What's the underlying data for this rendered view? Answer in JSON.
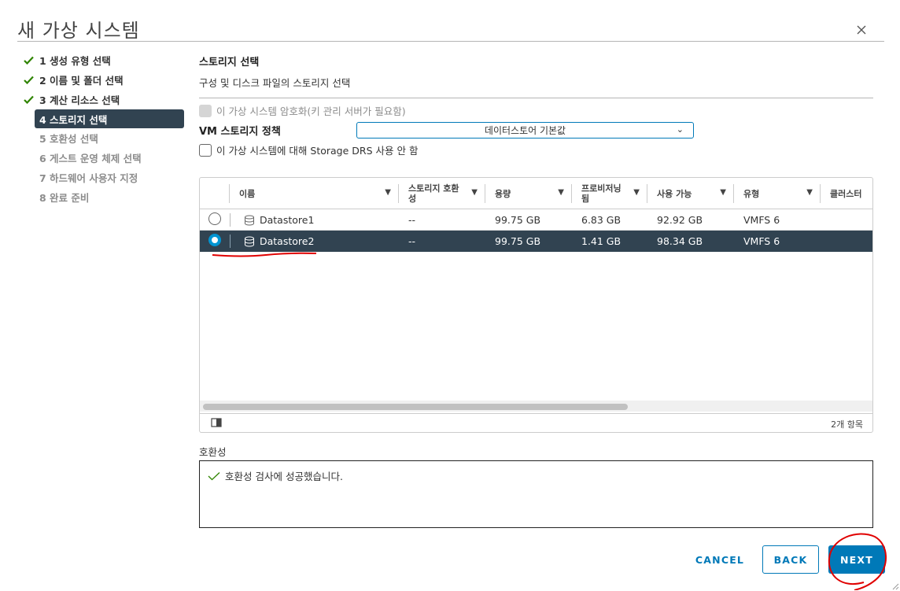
{
  "dialog": {
    "title": "새 가상 시스템"
  },
  "steps": [
    {
      "label": "1 생성 유형 선택",
      "state": "done"
    },
    {
      "label": "2 이름 및 폴더 선택",
      "state": "done"
    },
    {
      "label": "3 계산 리소스 선택",
      "state": "done"
    },
    {
      "label": "4 스토리지 선택",
      "state": "active"
    },
    {
      "label": "5 호환성 선택",
      "state": "future"
    },
    {
      "label": "6 게스트 운영 체제 선택",
      "state": "future"
    },
    {
      "label": "7 하드웨어 사용자 지정",
      "state": "future"
    },
    {
      "label": "8 완료 준비",
      "state": "future"
    }
  ],
  "section": {
    "title": "스토리지 선택",
    "subtitle": "구성 및 디스크 파일의 스토리지 선택"
  },
  "options": {
    "encrypt_label": "이 가상 시스템 암호화(키 관리 서버가 필요함)",
    "policy_label": "VM 스토리지 정책",
    "policy_value": "데이터스토어 기본값",
    "drs_label": "이 가상 시스템에 대해 Storage DRS 사용 안 함"
  },
  "grid": {
    "columns": [
      "이름",
      "스토리지 호환성",
      "용량",
      "프로비저닝됨",
      "사용 가능",
      "유형",
      "클러스터"
    ],
    "rows": [
      {
        "name": "Datastore1",
        "compat": "--",
        "capacity": "99.75 GB",
        "provisioned": "6.83 GB",
        "free": "92.92 GB",
        "type": "VMFS 6",
        "cluster": "",
        "selected": false
      },
      {
        "name": "Datastore2",
        "compat": "--",
        "capacity": "99.75 GB",
        "provisioned": "1.41 GB",
        "free": "98.34 GB",
        "type": "VMFS 6",
        "cluster": "",
        "selected": true
      }
    ],
    "count": "2개 항목"
  },
  "compatibility": {
    "label": "호환성",
    "message": "호환성 검사에 성공했습니다."
  },
  "buttons": {
    "cancel": "CANCEL",
    "back": "BACK",
    "next": "NEXT"
  },
  "colors": {
    "accent": "#0079b8",
    "selected_row": "#314351",
    "check": "#2f8400",
    "annotation": "#e00000"
  },
  "icons": {
    "close": "close-icon",
    "check": "check-icon",
    "filter": "filter-icon",
    "datastore": "datastore-icon",
    "chevron": "chevron-down-icon",
    "columns": "column-toggle-icon"
  }
}
